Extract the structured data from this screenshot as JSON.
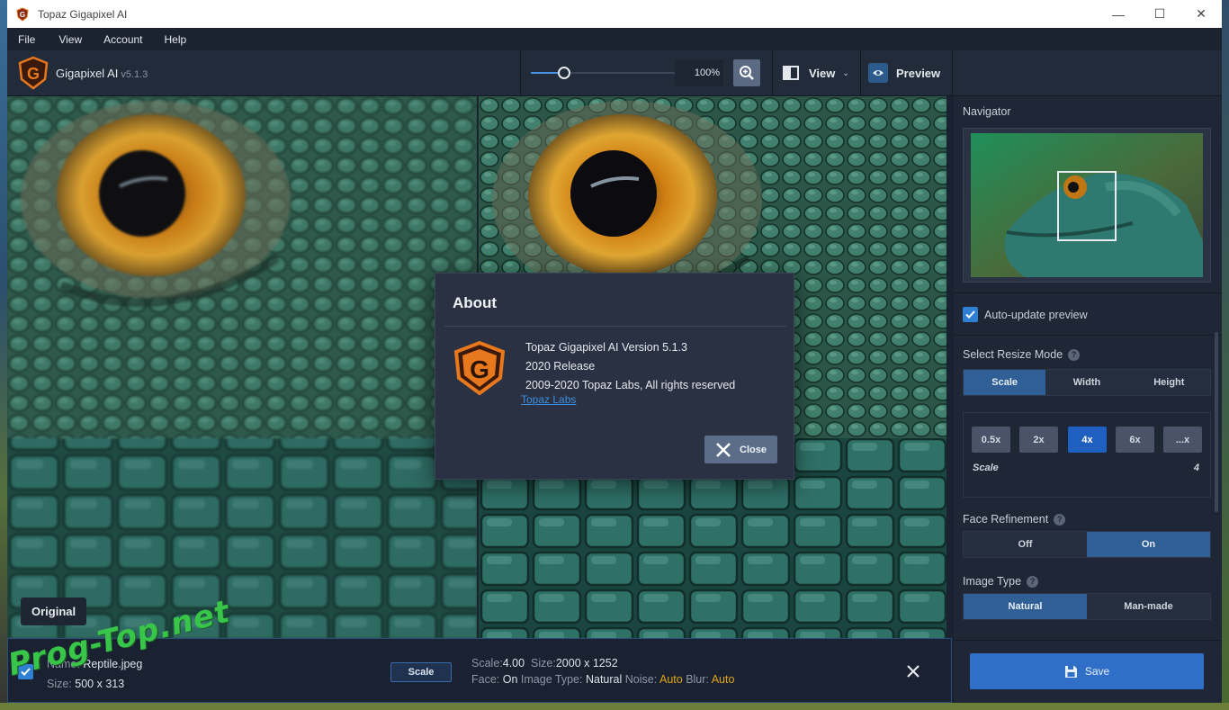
{
  "window": {
    "title": "Topaz Gigapixel AI",
    "minimize": "—",
    "maximize": "☐",
    "close": "✕"
  },
  "menu": [
    "File",
    "View",
    "Account",
    "Help"
  ],
  "toolbar": {
    "brand": "Gigapixel AI",
    "version": "v5.1.3",
    "zoom": "100%",
    "zoom_fraction": 0.2,
    "view_label": "View",
    "preview_label": "Preview"
  },
  "canvas": {
    "original_label": "Original"
  },
  "panel": {
    "navigator_title": "Navigator",
    "auto_update_label": "Auto-update preview",
    "resize_mode_title": "Select Resize Mode",
    "resize_modes": [
      "Scale",
      "Width",
      "Height"
    ],
    "active_resize_mode": "Scale",
    "scale_options": [
      "0.5x",
      "2x",
      "4x",
      "6x",
      "...x"
    ],
    "active_scale": "4x",
    "scale_label": "Scale",
    "scale_value": "4",
    "face_title": "Face Refinement",
    "face_options": [
      "Off",
      "On"
    ],
    "image_type_title": "Image Type",
    "image_type_options": [
      "Natural",
      "Man-made"
    ],
    "save_label": "Save",
    "help_glyph": "?"
  },
  "bottom": {
    "name_label": "Name:",
    "name_value": "Reptile.jpeg",
    "size_label": "Size:",
    "size_value": "500 x 313",
    "scale_btn": "Scale",
    "scale_label": "Scale:",
    "scale_value": "4.00",
    "out_size_label": "Size:",
    "out_size_value": "2000 x 1252",
    "face_label": "Face:",
    "face_value": "On",
    "image_type_label": "Image Type:",
    "image_type_value": "Natural",
    "noise_label": "Noise:",
    "noise_value": "Auto",
    "blur_label": "Blur:",
    "blur_value": "Auto"
  },
  "about": {
    "title": "About",
    "line1": "Topaz Gigapixel AI Version 5.1.3",
    "line2": "2020 Release",
    "line3": "2009-2020 Topaz Labs, All rights reserved",
    "link": "Topaz Labs",
    "close_label": "Close"
  },
  "watermark": "Prog-Top.net",
  "colors": {
    "accent": "#2f6fc8",
    "active_segment": "#2f5f94",
    "warning_yellow": "#e0a516",
    "logo_orange": "#e8781e"
  }
}
